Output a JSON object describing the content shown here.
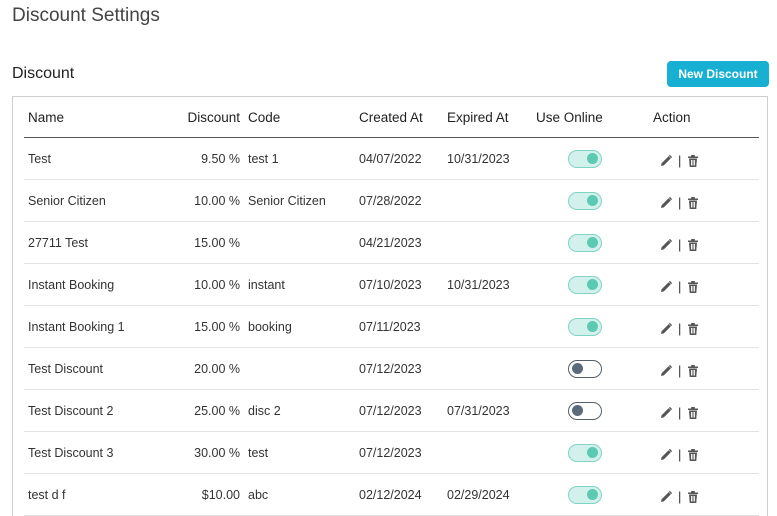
{
  "page": {
    "title": "Discount Settings"
  },
  "section": {
    "title": "Discount",
    "new_button": "New Discount"
  },
  "table": {
    "headers": [
      "Name",
      "Discount",
      "Code",
      "Created At",
      "Expired At",
      "Use Online",
      "Action"
    ],
    "rows": [
      {
        "name": "Test",
        "discount": "9.50 %",
        "code": "test 1",
        "created": "04/07/2022",
        "expired": "10/31/2023",
        "online": true
      },
      {
        "name": "Senior Citizen",
        "discount": "10.00 %",
        "code": "Senior Citizen",
        "created": "07/28/2022",
        "expired": "",
        "online": true
      },
      {
        "name": "27711 Test",
        "discount": "15.00 %",
        "code": "",
        "created": "04/21/2023",
        "expired": "",
        "online": true
      },
      {
        "name": "Instant Booking",
        "discount": "10.00 %",
        "code": "instant",
        "created": "07/10/2023",
        "expired": "10/31/2023",
        "online": true
      },
      {
        "name": "Instant Booking 1",
        "discount": "15.00 %",
        "code": "booking",
        "created": "07/11/2023",
        "expired": "",
        "online": true
      },
      {
        "name": "Test Discount",
        "discount": "20.00 %",
        "code": "",
        "created": "07/12/2023",
        "expired": "",
        "online": false
      },
      {
        "name": "Test Discount 2",
        "discount": "25.00 %",
        "code": "disc 2",
        "created": "07/12/2023",
        "expired": "07/31/2023",
        "online": false
      },
      {
        "name": "Test Discount 3",
        "discount": "30.00 %",
        "code": "test",
        "created": "07/12/2023",
        "expired": "",
        "online": true
      },
      {
        "name": "test d f",
        "discount": "$10.00",
        "code": "abc",
        "created": "02/12/2024",
        "expired": "02/29/2024",
        "online": true
      }
    ],
    "action_separator": "|"
  },
  "icons": {
    "edit": "pencil-icon",
    "delete": "trash-icon"
  },
  "colors": {
    "accent": "#17b0d3",
    "toggle_on": "#5cc9b2",
    "toggle_off": "#5c6b7c"
  }
}
